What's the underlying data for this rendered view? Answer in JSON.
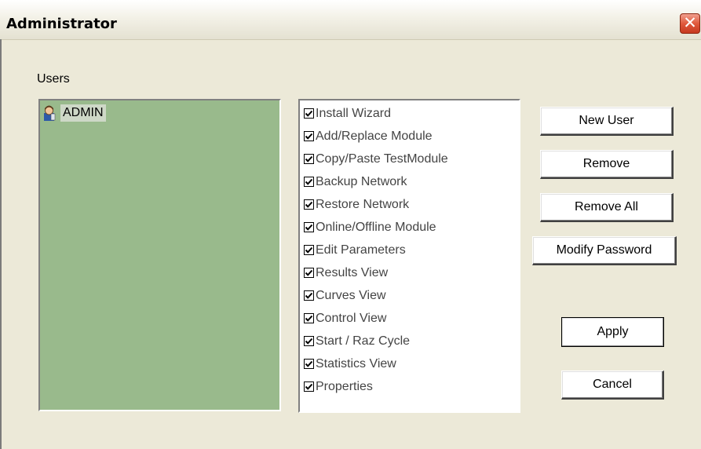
{
  "window": {
    "title": "Administrator",
    "close_glyph": "✕"
  },
  "users": {
    "label": "Users",
    "items": [
      {
        "name": "ADMIN",
        "icon": "user-icon"
      }
    ]
  },
  "permissions": [
    {
      "label": "Install Wizard",
      "checked": true
    },
    {
      "label": "Add/Replace Module",
      "checked": true
    },
    {
      "label": "Copy/Paste TestModule",
      "checked": true
    },
    {
      "label": "Backup Network",
      "checked": true
    },
    {
      "label": "Restore Network",
      "checked": true
    },
    {
      "label": "Online/Offline Module",
      "checked": true
    },
    {
      "label": "Edit Parameters",
      "checked": true
    },
    {
      "label": "Results View",
      "checked": true
    },
    {
      "label": "Curves View",
      "checked": true
    },
    {
      "label": "Control View",
      "checked": true
    },
    {
      "label": "Start / Raz Cycle",
      "checked": true
    },
    {
      "label": "Statistics View",
      "checked": true
    },
    {
      "label": "Properties",
      "checked": true
    }
  ],
  "buttons": {
    "new_user": "New User",
    "remove": "Remove",
    "remove_all": "Remove All",
    "modify_password": "Modify Password",
    "apply": "Apply",
    "cancel": "Cancel"
  },
  "colors": {
    "users_bg": "#99ba8c",
    "dialog_bg": "#ece9d8",
    "close_button": "#e0593c"
  }
}
